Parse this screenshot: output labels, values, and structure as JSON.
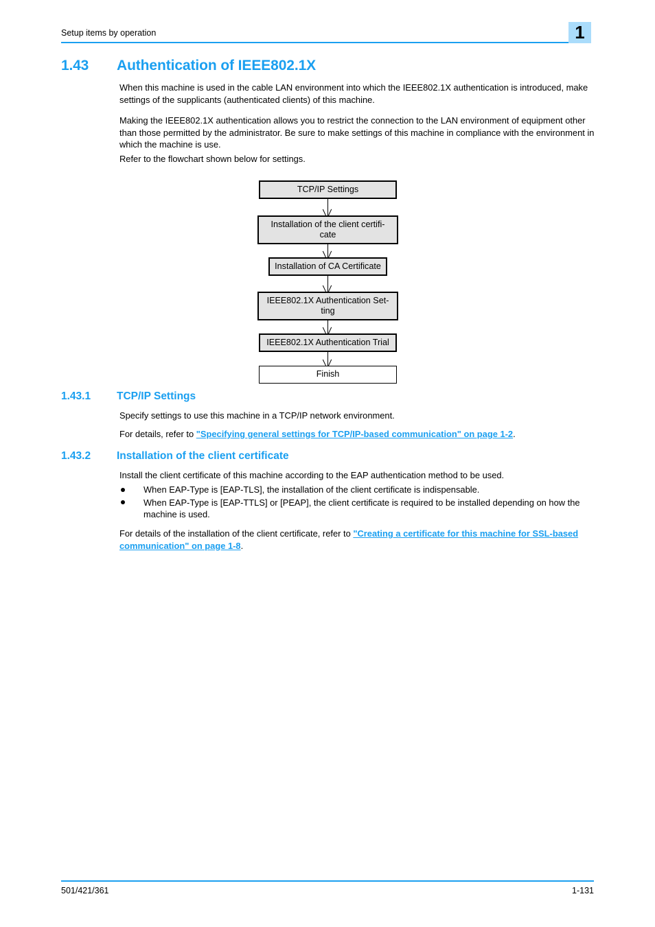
{
  "header": {
    "running_title": "Setup items by operation",
    "chapter_number": "1",
    "accent_color": "#1a9ff0",
    "tab_color": "#aadcfb"
  },
  "section": {
    "number": "1.43",
    "title": "Authentication of IEEE802.1X",
    "paragraphs": {
      "intro_1": "When this machine is used in the cable LAN environment into which the IEEE802.1X authentication is introduced, make settings of the supplicants (authenticated clients) of this machine.",
      "intro_2": "Making the IEEE802.1X authentication allows you to restrict the connection to the LAN environment of equipment other than those permitted by the administrator. Be sure to make settings of this machine in compliance with the environment in which the machine is use.",
      "intro_3": "Refer to the flowchart shown below for settings."
    }
  },
  "flowchart": {
    "boxes": [
      {
        "label": "TCP/IP Settings",
        "filled": true
      },
      {
        "label": "Installation of the client certifi-\ncate",
        "filled": true
      },
      {
        "label": "Installation of CA Certificate",
        "filled": true
      },
      {
        "label": "IEEE802.1X Authentication Set-\nting",
        "filled": true
      },
      {
        "label": "IEEE802.1X Authentication Trial",
        "filled": true
      },
      {
        "label": "Finish",
        "filled": false
      }
    ],
    "fill_color": "#e3e3e3",
    "border_color": "#000000"
  },
  "subsections": [
    {
      "number": "1.43.1",
      "title": "TCP/IP Settings",
      "body_1": "Specify settings to use this machine in a TCP/IP network environment.",
      "ref_prefix": "For details, refer to ",
      "ref_link": "\"Specifying general settings for TCP/IP-based communication\" on page 1-2",
      "ref_suffix": "."
    },
    {
      "number": "1.43.2",
      "title": "Installation of the client certificate",
      "body_1": "Install the client certificate of this machine according to the EAP authentication method to be used.",
      "bullets": [
        "When EAP-Type is [EAP-TLS], the installation of the client certificate is indispensable.",
        "When EAP-Type is [EAP-TTLS] or [PEAP], the client certificate is required to be installed depending on how the machine is used."
      ],
      "ref_prefix": "For details of the installation of the client certificate, refer to ",
      "ref_link": "\"Creating a certificate for this machine for SSL-based communication\" on page 1-8",
      "ref_suffix": "."
    }
  ],
  "footer": {
    "model": "501/421/361",
    "page_number": "1-131"
  }
}
